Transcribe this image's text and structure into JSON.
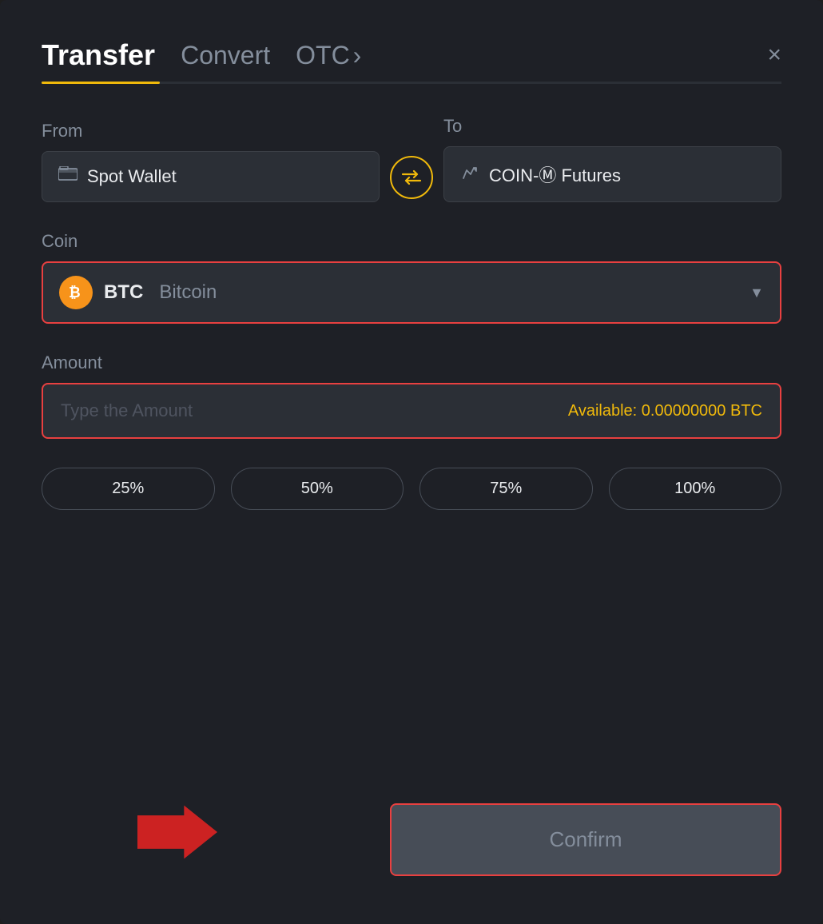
{
  "header": {
    "tab_transfer": "Transfer",
    "tab_convert": "Convert",
    "tab_otc": "OTC",
    "tab_otc_arrow": "›",
    "close_label": "×"
  },
  "from_section": {
    "label": "From",
    "wallet_name": "Spot Wallet"
  },
  "to_section": {
    "label": "To",
    "wallet_name": "COIN-Ⓜ Futures"
  },
  "swap": {
    "icon": "⇄"
  },
  "coin_section": {
    "label": "Coin",
    "coin_symbol": "BTC",
    "coin_name": "Bitcoin",
    "btc_letter": "₿"
  },
  "amount_section": {
    "label": "Amount",
    "placeholder": "Type the Amount",
    "available_label": "Available:",
    "available_value": "0.00000000 BTC"
  },
  "percent_buttons": {
    "p25": "25%",
    "p50": "50%",
    "p75": "75%",
    "p100": "100%"
  },
  "confirm_button": {
    "label": "Confirm"
  }
}
